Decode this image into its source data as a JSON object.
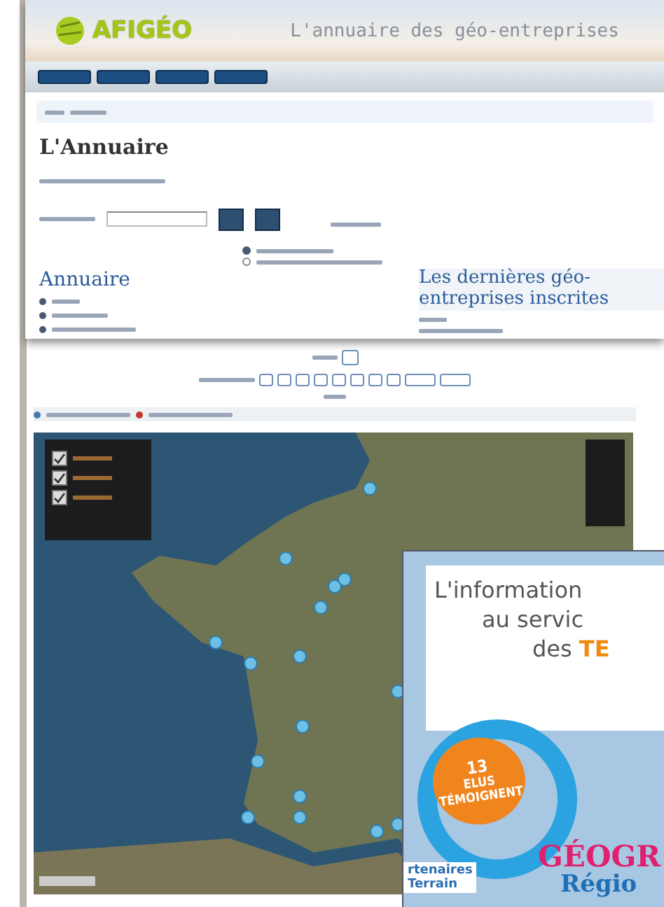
{
  "header": {
    "logo": "AFIGÉO",
    "site_title": "L'annuaire des géo-entreprises"
  },
  "page": {
    "search_options": [
      {
        "selected": true
      },
      {
        "selected": false
      }
    ],
    "heading": "L'Annuaire",
    "left_heading": "Annuaire",
    "right_heading": "Les dernières géo-entreprises inscrites"
  },
  "map": {
    "layers": [
      {
        "checked": true
      },
      {
        "checked": true
      },
      {
        "checked": true
      }
    ]
  },
  "magazine": {
    "headline": [
      "L'information",
      "au servic"
    ],
    "headline_end": {
      "prefix": "des ",
      "accent": "TE"
    },
    "badge": [
      "13",
      "ELUS",
      "TÉMOIGNENT"
    ],
    "words": [
      {
        "text": "GÉOGR",
        "kind": "big"
      },
      {
        "text": "Régio",
        "kind": "mid"
      },
      {
        "text": "rtenaires",
        "kind": "small"
      },
      {
        "text": "Terrain",
        "kind": "small"
      }
    ]
  }
}
